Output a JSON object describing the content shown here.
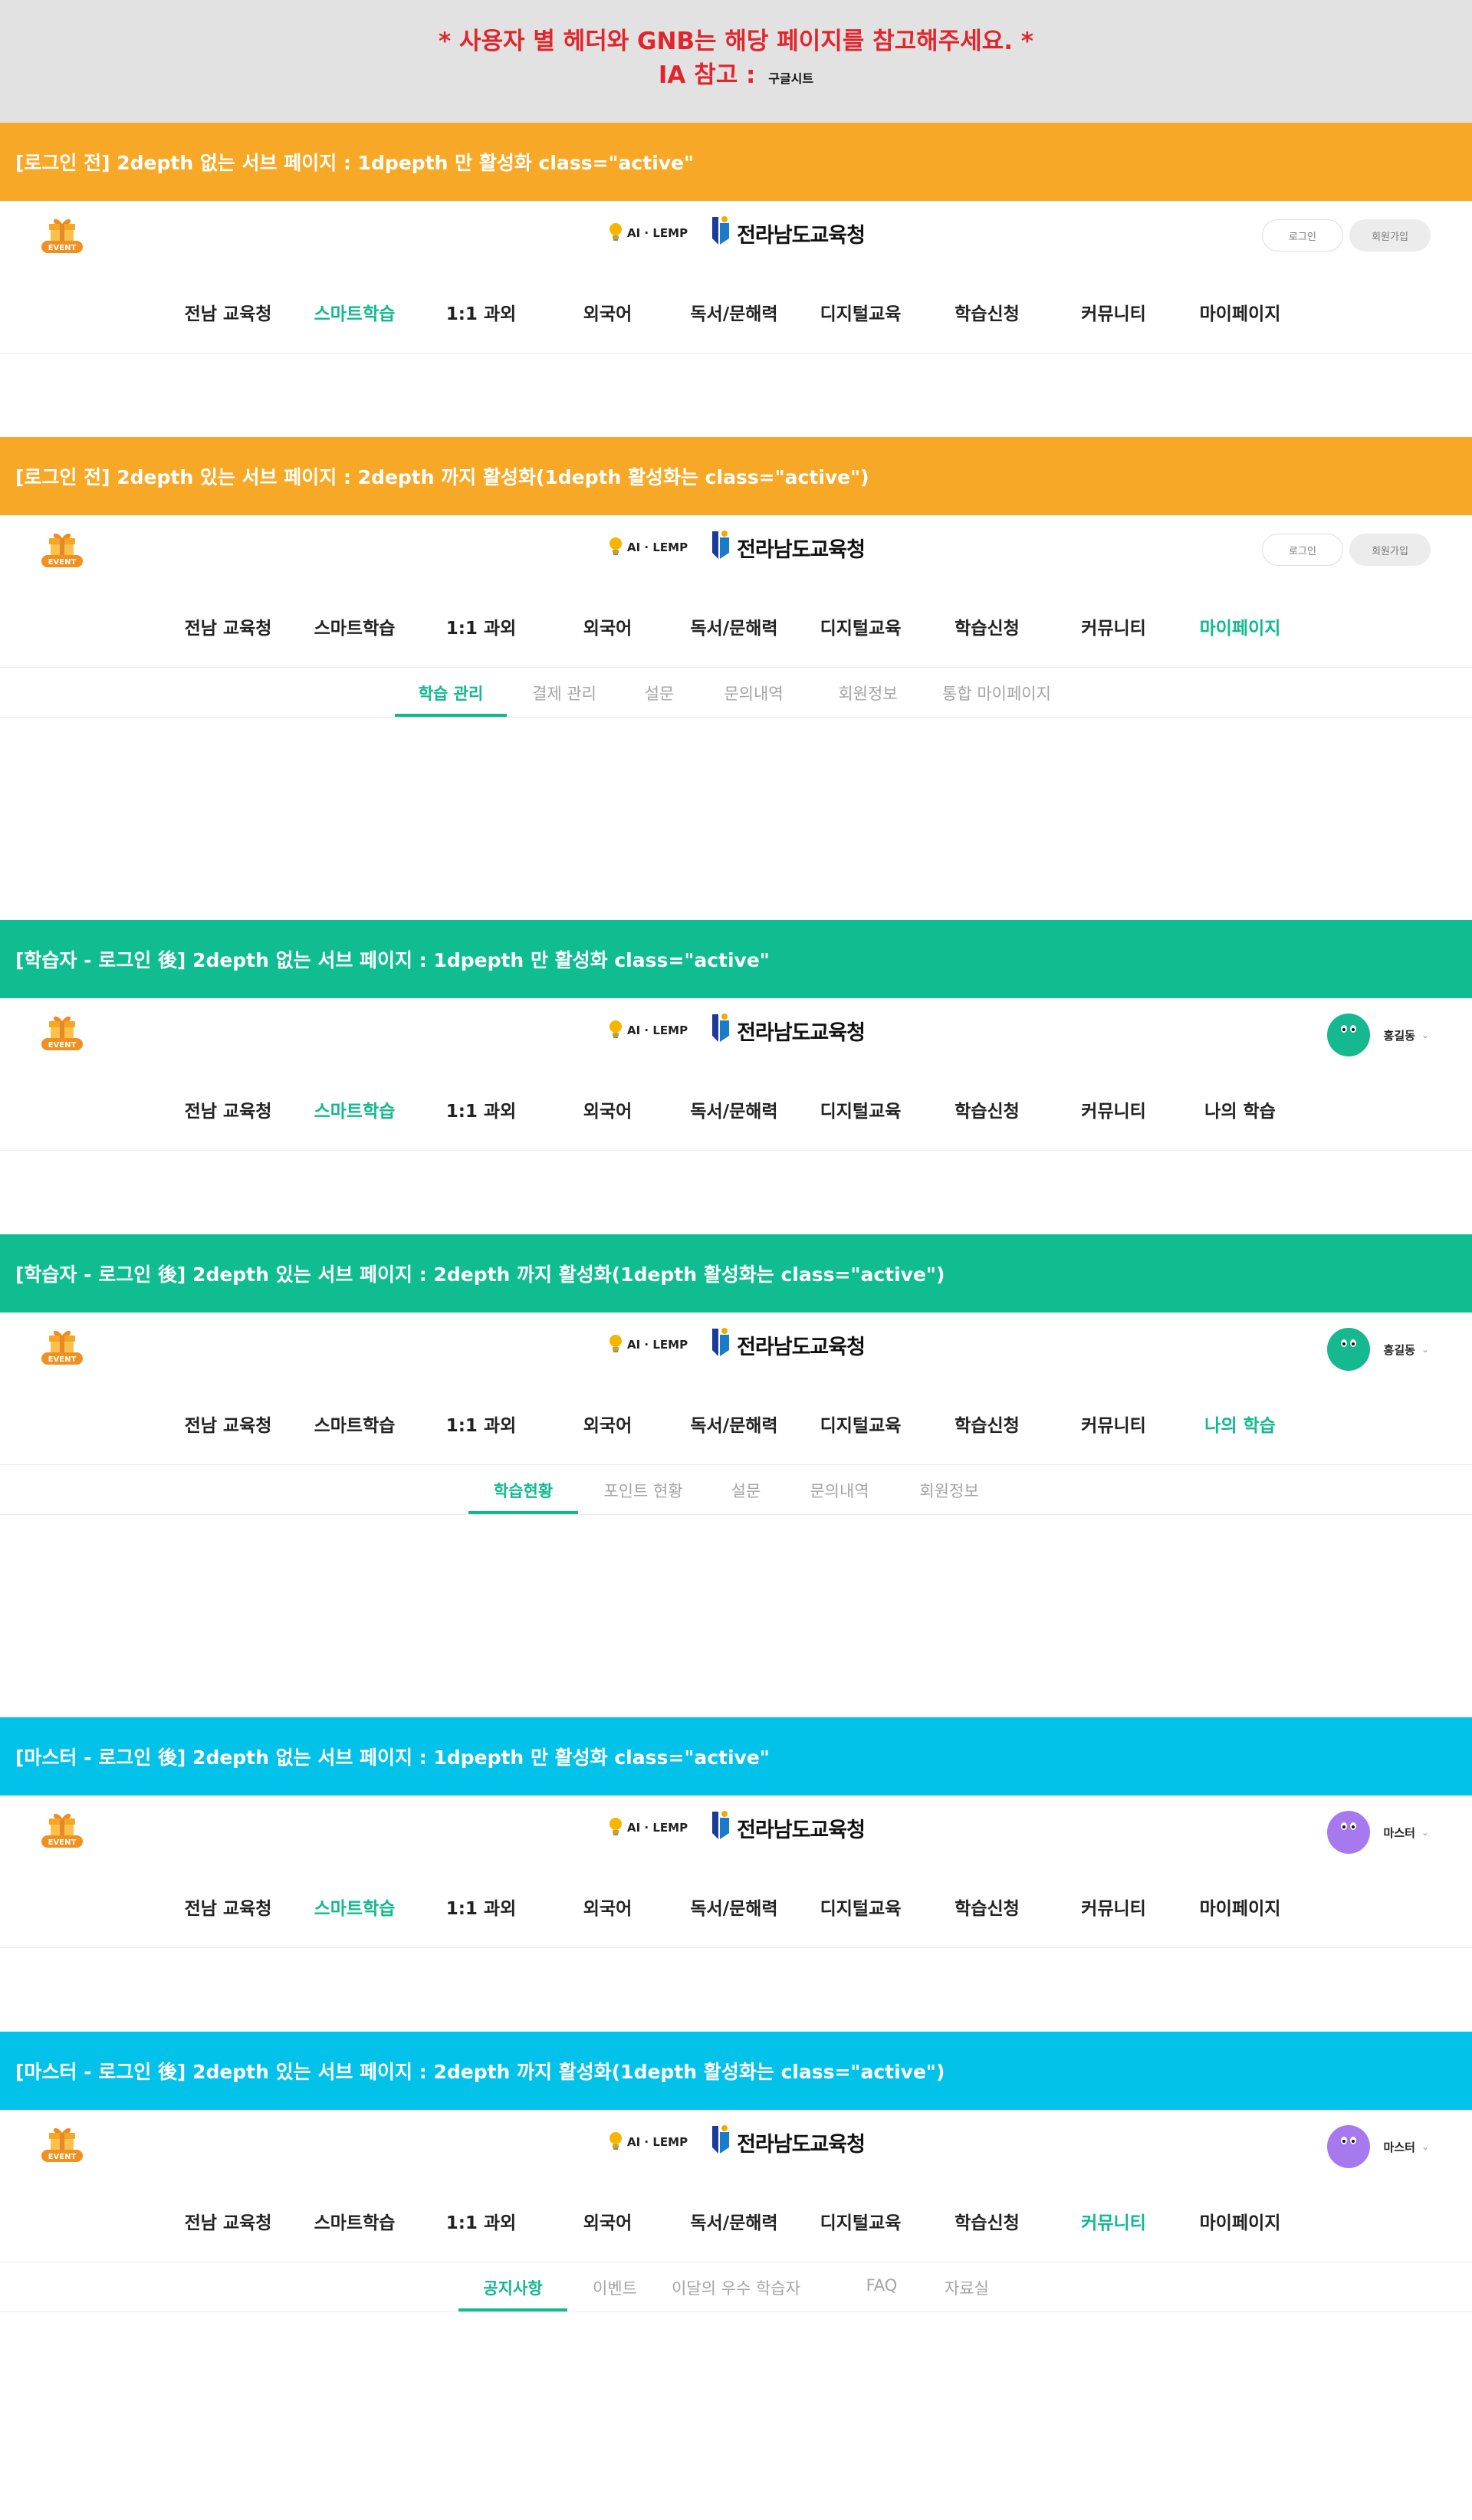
{
  "notice": {
    "line1": "* 사용자 별 헤더와 GNB는 해당 페이지를 참고해주세요. *",
    "line2_prefix": "IA 참고 :",
    "ia_link": "구글시트"
  },
  "logo": {
    "ai_lemp": "AI · LEMP",
    "edu": "전라남도교육청"
  },
  "event_label": "EVENT",
  "auth": {
    "login": "로그인",
    "join": "회원가입"
  },
  "colors": {
    "orange": "#f7a826",
    "green": "#0fbd91",
    "blue": "#03c2ea",
    "active": "#11b98e"
  },
  "sections": [
    {
      "title": "[로그인 전] 2depth 없는 서브 페이지 : 1dpepth 만 활성화 class=\"active\"",
      "gnb": [
        "전남 교육청",
        "스마트학습",
        "1:1 과외",
        "외국어",
        "독서/문해력",
        "디지털교육",
        "학습신청",
        "커뮤니티",
        "마이페이지"
      ],
      "active_gnb": "스마트학습"
    },
    {
      "title": "[로그인 전] 2depth 있는 서브 페이지 : 2depth 까지 활성화(1depth 활성화는 class=\"active\")",
      "gnb": [
        "전남 교육청",
        "스마트학습",
        "1:1 과외",
        "외국어",
        "독서/문해력",
        "디지털교육",
        "학습신청",
        "커뮤니티",
        "마이페이지"
      ],
      "active_gnb": "마이페이지",
      "sub": [
        "학습 관리",
        "결제 관리",
        "설문",
        "문의내역",
        "회원정보",
        "통합 마이페이지"
      ],
      "active_sub": "학습 관리"
    },
    {
      "title": "[학습자 - 로그인 後] 2depth 없는 서브 페이지 : 1dpepth 만 활성화 class=\"active\"",
      "user": "홍길동",
      "gnb": [
        "전남 교육청",
        "스마트학습",
        "1:1 과외",
        "외국어",
        "독서/문해력",
        "디지털교육",
        "학습신청",
        "커뮤니티",
        "나의 학습"
      ],
      "active_gnb": "스마트학습"
    },
    {
      "title": "[학습자 - 로그인 後] 2depth 있는 서브 페이지 : 2depth 까지 활성화(1depth 활성화는 class=\"active\")",
      "user": "홍길동",
      "gnb": [
        "전남 교육청",
        "스마트학습",
        "1:1 과외",
        "외국어",
        "독서/문해력",
        "디지털교육",
        "학습신청",
        "커뮤니티",
        "나의 학습"
      ],
      "active_gnb": "나의 학습",
      "sub": [
        "학습현황",
        "포인트 현황",
        "설문",
        "문의내역",
        "회원정보"
      ],
      "active_sub": "학습현황"
    },
    {
      "title": "[마스터 - 로그인 後] 2depth 없는 서브 페이지 : 1dpepth 만 활성화 class=\"active\"",
      "user": "마스터",
      "gnb": [
        "전남 교육청",
        "스마트학습",
        "1:1 과외",
        "외국어",
        "독서/문해력",
        "디지털교육",
        "학습신청",
        "커뮤니티",
        "마이페이지"
      ],
      "active_gnb": "스마트학습"
    },
    {
      "title": "[마스터 - 로그인 後] 2depth 있는 서브 페이지 : 2depth 까지 활성화(1depth 활성화는 class=\"active\")",
      "user": "마스터",
      "gnb": [
        "전남 교육청",
        "스마트학습",
        "1:1 과외",
        "외국어",
        "독서/문해력",
        "디지털교육",
        "학습신청",
        "커뮤니티",
        "마이페이지"
      ],
      "active_gnb": "커뮤니티",
      "sub": [
        "공지사항",
        "이벤트",
        "이달의 우수 학습자",
        "FAQ",
        "자료실"
      ],
      "active_sub": "공지사항"
    }
  ]
}
